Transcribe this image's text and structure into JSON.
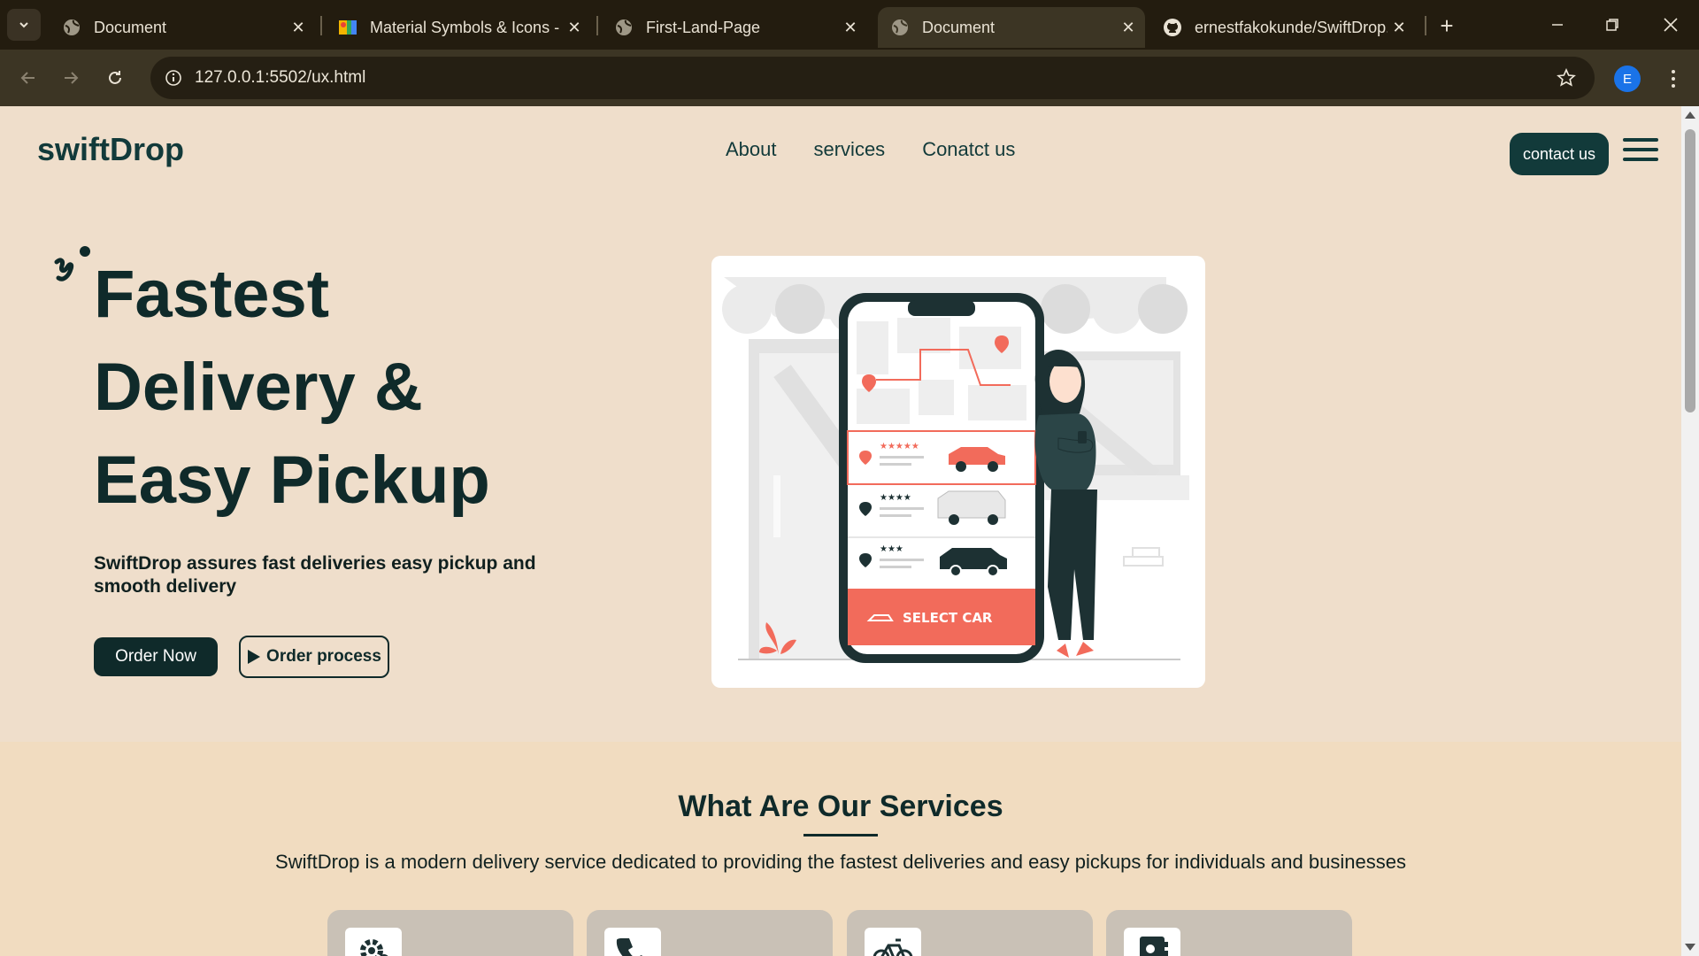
{
  "browser": {
    "tabs": [
      {
        "title": "Document",
        "active": false
      },
      {
        "title": "Material Symbols & Icons - G",
        "active": false
      },
      {
        "title": "First-Land-Page",
        "active": false
      },
      {
        "title": "Document",
        "active": true
      },
      {
        "title": "ernestfakokunde/SwiftDrop.",
        "active": false
      }
    ],
    "url": "127.0.0.1:5502/ux.html",
    "profile_initial": "E"
  },
  "site": {
    "brand": "swiftDrop",
    "nav": [
      "About",
      "services",
      "Conatct us"
    ],
    "contact_button": "contact us"
  },
  "hero": {
    "title_lines": [
      "Fastest",
      "Delivery &",
      "Easy Pickup"
    ],
    "subtitle": "SwiftDrop assures fast deliveries easy pickup and smooth delivery",
    "order_button": "Order Now",
    "process_button": "Order process",
    "illustration_button": "SELECT CAR"
  },
  "services": {
    "title": "What Are Our Services",
    "description": "SwiftDrop is a modern delivery service dedicated to providing the fastest deliveries and easy pickups for individuals and businesses",
    "cards": [
      {
        "icon": "settings-icon"
      },
      {
        "icon": "phone-icon"
      },
      {
        "icon": "bicycle-icon"
      },
      {
        "icon": "contact-card-icon"
      }
    ]
  },
  "colors": {
    "primary": "#0f2a2a",
    "hero_bg": "#efdecb",
    "services_bg": "#f1dcc0",
    "accent": "#f26b5b"
  }
}
